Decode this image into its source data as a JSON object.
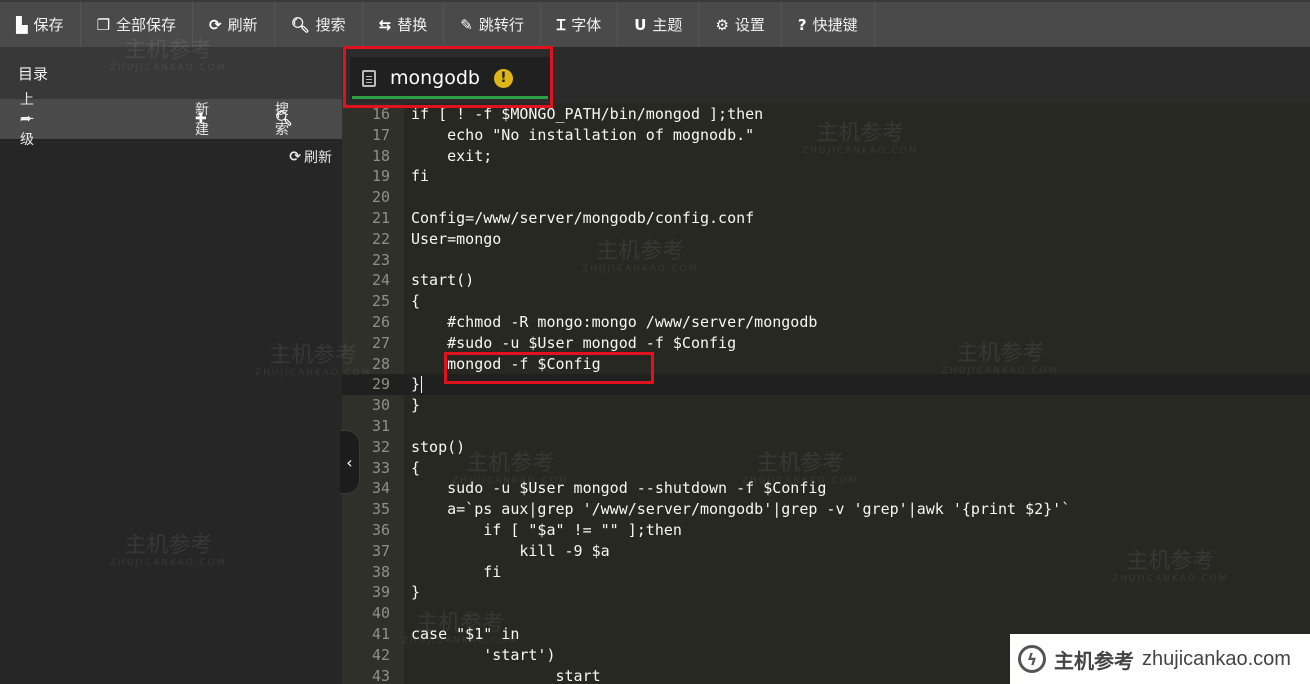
{
  "toolbar": {
    "buttons": [
      {
        "icon": "save-icon",
        "glyph": "▙",
        "label": "保存"
      },
      {
        "icon": "save-all-icon",
        "glyph": "❐",
        "label": "全部保存"
      },
      {
        "icon": "refresh-icon",
        "glyph": "⟳",
        "label": "刷新"
      },
      {
        "icon": "search-icon",
        "glyph": "🔍︎",
        "label": "搜索"
      },
      {
        "icon": "replace-icon",
        "glyph": "⇆",
        "label": "替换"
      },
      {
        "icon": "pin-icon",
        "glyph": "✎",
        "label": "跳转行"
      },
      {
        "icon": "font-icon",
        "glyph": "Ɪ",
        "label": "字体"
      },
      {
        "icon": "magnet-icon",
        "glyph": "U",
        "label": "主题"
      },
      {
        "icon": "gear-icon",
        "glyph": "⚙",
        "label": "设置"
      },
      {
        "icon": "help-icon",
        "glyph": "?",
        "label": "快捷键"
      }
    ]
  },
  "sidebar": {
    "title": "目录",
    "up_label": "上一级",
    "up_glyph": "➦",
    "new_label": "新建",
    "new_glyph": "✚",
    "search_label": "搜索",
    "search_glyph": "🔍︎",
    "refresh_label": "刷新",
    "refresh_glyph": "⟳",
    "collapse_glyph": "‹"
  },
  "tab": {
    "filename": "mongodb",
    "warning_glyph": "!"
  },
  "editor": {
    "active_line": 29,
    "highlighted_line": 28,
    "lines": [
      {
        "n": "16",
        "code": "if [ ! -f $MONGO_PATH/bin/mongod ];then"
      },
      {
        "n": "17",
        "code": "    echo \"No installation of mognodb.\""
      },
      {
        "n": "18",
        "code": "    exit;"
      },
      {
        "n": "19",
        "code": "fi"
      },
      {
        "n": "20",
        "code": ""
      },
      {
        "n": "21",
        "code": "Config=/www/server/mongodb/config.conf"
      },
      {
        "n": "22",
        "code": "User=mongo"
      },
      {
        "n": "23",
        "code": ""
      },
      {
        "n": "24",
        "code": "start()"
      },
      {
        "n": "25",
        "code": "{"
      },
      {
        "n": "26",
        "code": "    #chmod -R mongo:mongo /www/server/mongodb"
      },
      {
        "n": "27",
        "code": "    #sudo -u $User mongod -f $Config"
      },
      {
        "n": "28",
        "code": "    mongod -f $Config"
      },
      {
        "n": "29",
        "code": "}"
      },
      {
        "n": "30",
        "code": "}"
      },
      {
        "n": "31",
        "code": ""
      },
      {
        "n": "32",
        "code": "stop()"
      },
      {
        "n": "33",
        "code": "{"
      },
      {
        "n": "34",
        "code": "    sudo -u $User mongod --shutdown -f $Config"
      },
      {
        "n": "35",
        "code": "    a=`ps aux|grep '/www/server/mongodb'|grep -v 'grep'|awk '{print $2}'`"
      },
      {
        "n": "36",
        "code": "        if [ \"$a\" != \"\" ];then"
      },
      {
        "n": "37",
        "code": "            kill -9 $a"
      },
      {
        "n": "38",
        "code": "        fi"
      },
      {
        "n": "39",
        "code": "}"
      },
      {
        "n": "40",
        "code": ""
      },
      {
        "n": "41",
        "code": "case \"$1\" in"
      },
      {
        "n": "42",
        "code": "        'start')"
      },
      {
        "n": "43",
        "code": "                start"
      }
    ]
  },
  "watermark": {
    "cn": "主机参考",
    "en": "ZHUJICANKAO.COM"
  },
  "brand": {
    "logo_glyph": "ϟ",
    "cn": "主机参考",
    "en": "zhujicankao.com"
  },
  "colors": {
    "highlight_box": "#e0121d",
    "tab_underline": "#2e9e43",
    "warning": "#e0b617"
  }
}
